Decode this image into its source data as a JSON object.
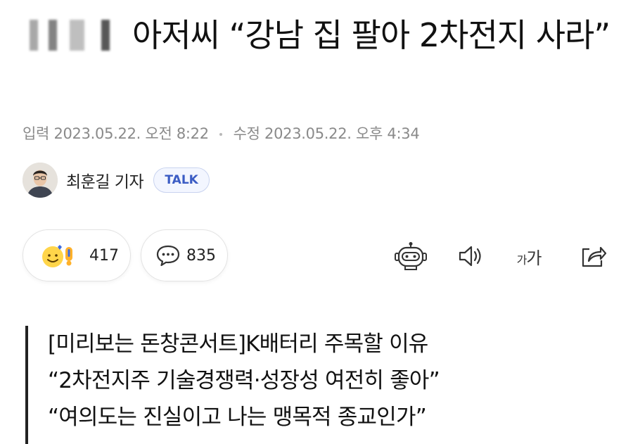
{
  "article": {
    "headline": "아저씨 “강남 집 팔아 2차전지 사라”",
    "meta": {
      "input_label": "입력",
      "input_time": "2023.05.22. 오전 8:22",
      "modified_label": "수정",
      "modified_time": "2023.05.22. 오후 4:34"
    },
    "author": {
      "name": "최훈길 기자",
      "talk_label": "TALK"
    },
    "actions": {
      "reaction_count": "417",
      "comment_count": "835",
      "font_size_small": "가",
      "font_size_large": "가"
    },
    "related": [
      "[미리보는 돈창콘서트]K배터리 주목할 이유",
      "“2차전지주 기술경쟁력·성장성 여전히 좋아”",
      "“여의도는 진실이고 나는 맹목적 종교인가”"
    ]
  },
  "icons": [
    "reaction-emoji-icon",
    "comment-bubble-icon",
    "summary-bot-icon",
    "speaker-icon",
    "font-size-icon",
    "share-icon"
  ],
  "colors": {
    "talk_text": "#3b5cc4",
    "talk_bg": "#f3f6ff",
    "meta_text": "#8a8a8a",
    "accent_bar": "#222222"
  }
}
